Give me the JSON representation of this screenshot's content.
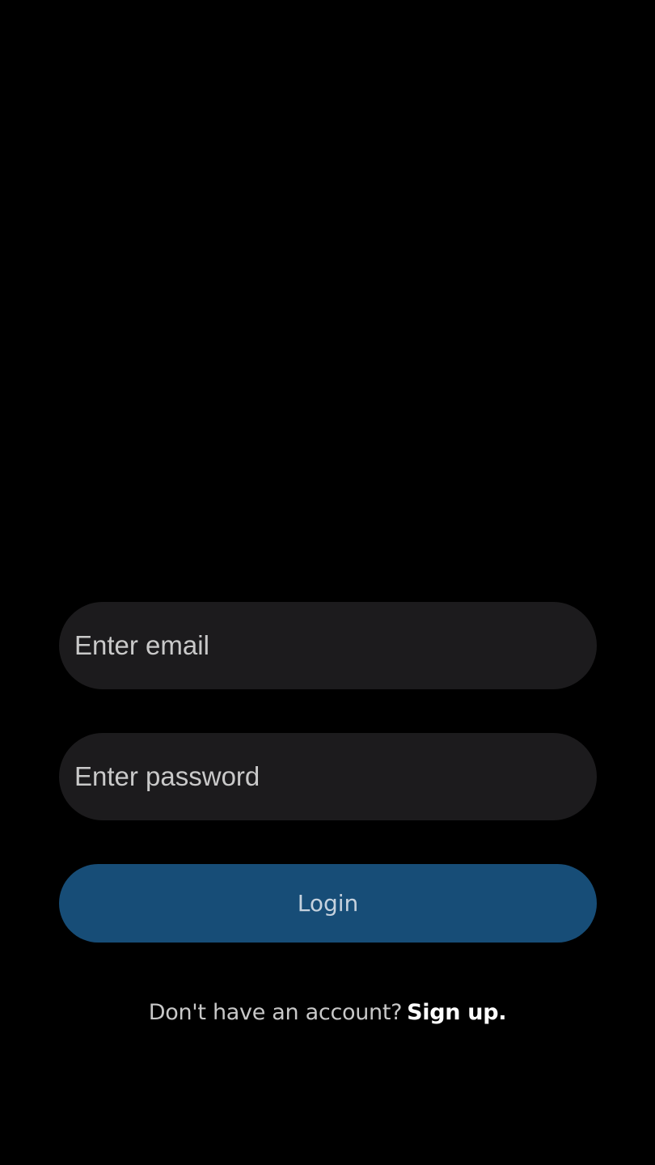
{
  "login_form": {
    "email_placeholder": "Enter email",
    "email_value": "",
    "password_placeholder": "Enter password",
    "password_value": "",
    "login_label": "Login"
  },
  "signup_prompt": {
    "text": "Don't have an account?",
    "link_label": "Sign up."
  },
  "colors": {
    "background": "#000000",
    "field_background": "#1c1b1d",
    "button_background": "#174d77",
    "button_text": "#c6d2de",
    "link_text": "#ffffff"
  }
}
